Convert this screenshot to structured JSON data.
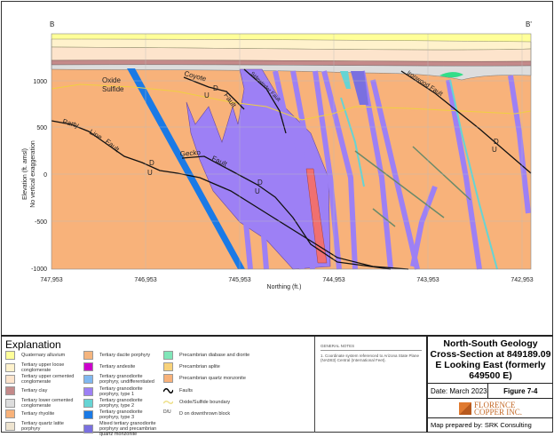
{
  "section": {
    "left_label": "B",
    "right_label": "B'"
  },
  "axes": {
    "ylabel1": "Elevation (ft. amsl)",
    "ylabel2": "No vertical exaggeration",
    "xlabel": "Northing (ft.)",
    "yticks": [
      "1000",
      "500",
      "0",
      "-500",
      "-1000"
    ],
    "xticks": [
      "747,953",
      "746,953",
      "745,953",
      "744,953",
      "743,953",
      "742,953"
    ]
  },
  "annotations": {
    "oxide": "Oxide",
    "sulfide": "Sulfide",
    "d": "D",
    "u": "U"
  },
  "faults": {
    "party": [
      "Party",
      "Line",
      "Fault"
    ],
    "coyote": "Coyote",
    "coyote2": "Fault",
    "gecko": "Gecko",
    "gecko2": "Fault",
    "sidewinder": "Sidewinder Fault",
    "ironwood": "Ironwood Fault"
  },
  "legend": {
    "title": "Explanation",
    "items": [
      {
        "label": "Quaternary alluvium",
        "color": "#ffff99"
      },
      {
        "label": "Tertiary upper loose conglomerate",
        "color": "#fff2cc"
      },
      {
        "label": "Tertiary upper cemented conglomerate",
        "color": "#fde4cc"
      },
      {
        "label": "Tertiary clay",
        "color": "#c48a8a"
      },
      {
        "label": "Tertiary lower cemented conglomerate",
        "color": "#dddddd"
      },
      {
        "label": "Tertiary rhyolite",
        "color": "#f8b27a"
      },
      {
        "label": "Tertiary quartz latite porphyry",
        "color": "#eee4d0"
      },
      {
        "label": "Tertiary dacite porphyry",
        "color": "#f5b57e"
      },
      {
        "label": "Tertiary andesite",
        "color": "#cc00cc"
      },
      {
        "label": "Tertiary granodiorite porphyry, undifferentiated",
        "color": "#80b8f0"
      },
      {
        "label": "Tertiary granodiorite porphyry, type 1",
        "color": "#9d80f5"
      },
      {
        "label": "Tertiary granodiorite porphyry, type 2",
        "color": "#66d4d4"
      },
      {
        "label": "Tertiary granodiorite porphyry, type 3",
        "color": "#1a7ae6"
      },
      {
        "label": "Mixed tertiary granodiorite porphyry and precambrian quartz monzonite",
        "color": "#7a70e0"
      },
      {
        "label": "Precambrian diabase and diorite",
        "color": "#80e6b8"
      },
      {
        "label": "Precambrian aplite",
        "color": "#f8d27a"
      },
      {
        "label": "Precambrian quartz monzonite",
        "color": "#f8b27a"
      },
      {
        "label": "Faults",
        "symbol": "fault"
      },
      {
        "label": "Oxide/Sulfide boundary",
        "symbol": "boundary"
      },
      {
        "label": "D on downthrown block",
        "symbol": "DU"
      }
    ]
  },
  "notes": {
    "heading": "GENERAL NOTES",
    "items": [
      "1.  Coordinate system referenced to Arizona State Plane (NAD83) Central (International Feet)."
    ]
  },
  "titleblock": {
    "title": "North-South Geology Cross-Section at 849189.09 E Looking East (formerly 649500 E)",
    "date": "Date:  March 2023",
    "figure": "Figure 7-4",
    "logo1": "FLORENCE",
    "logo2": "COPPER INC.",
    "prepared": "Map prepared by: SRK Consulting"
  }
}
